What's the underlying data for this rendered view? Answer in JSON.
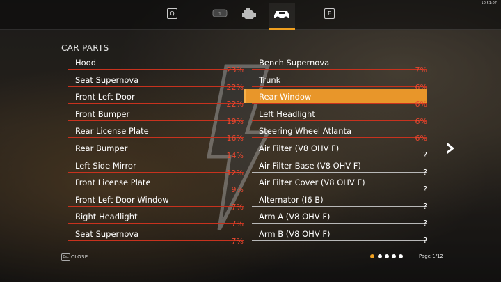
{
  "status": {
    "clock": "10:51:07"
  },
  "tabs": [
    {
      "key": "Q"
    },
    {
      "icon": "engine-block-icon"
    },
    {
      "icon": "engine-icon"
    },
    {
      "icon": "car-parts-icon",
      "active": true
    },
    {
      "key": "E"
    }
  ],
  "section_title": "CAR PARTS",
  "left_column": [
    {
      "label": "Hood",
      "value": "23%"
    },
    {
      "label": "Seat Supernova",
      "value": "22%"
    },
    {
      "label": "Front Left Door",
      "value": "22%"
    },
    {
      "label": "Front Bumper",
      "value": "19%"
    },
    {
      "label": "Rear License Plate",
      "value": "16%"
    },
    {
      "label": "Rear Bumper",
      "value": "14%"
    },
    {
      "label": "Left Side Mirror",
      "value": "12%"
    },
    {
      "label": "Front License Plate",
      "value": "9%"
    },
    {
      "label": "Front Left Door Window",
      "value": "7%"
    },
    {
      "label": "Right Headlight",
      "value": "7%"
    },
    {
      "label": "Seat Supernova",
      "value": "7%"
    }
  ],
  "right_column": [
    {
      "label": "Bench Supernova",
      "value": "7%"
    },
    {
      "label": "Trunk",
      "value": "6%"
    },
    {
      "label": "Rear Window",
      "value": "6%",
      "selected": true
    },
    {
      "label": "Left Headlight",
      "value": "6%"
    },
    {
      "label": "Steering Wheel Atlanta",
      "value": "6%"
    },
    {
      "label": "Air Filter (V8 OHV F)",
      "value": "?"
    },
    {
      "label": "Air Filter Base (V8 OHV F)",
      "value": "?"
    },
    {
      "label": "Air Filter Cover (V8 OHV F)",
      "value": "?"
    },
    {
      "label": "Alternator (I6 B)",
      "value": "?"
    },
    {
      "label": "Arm A (V8 OHV F)",
      "value": "?"
    },
    {
      "label": "Arm B (V8 OHV F)",
      "value": "?"
    }
  ],
  "footer": {
    "close_key": "Esc",
    "close_label": "CLOSE",
    "page_label": "Page 1/12",
    "page_dots": 5,
    "active_dot": 0
  },
  "colors": {
    "accent": "#f0a020",
    "percent": "#e84830",
    "selected_bg": "#e8962a"
  }
}
